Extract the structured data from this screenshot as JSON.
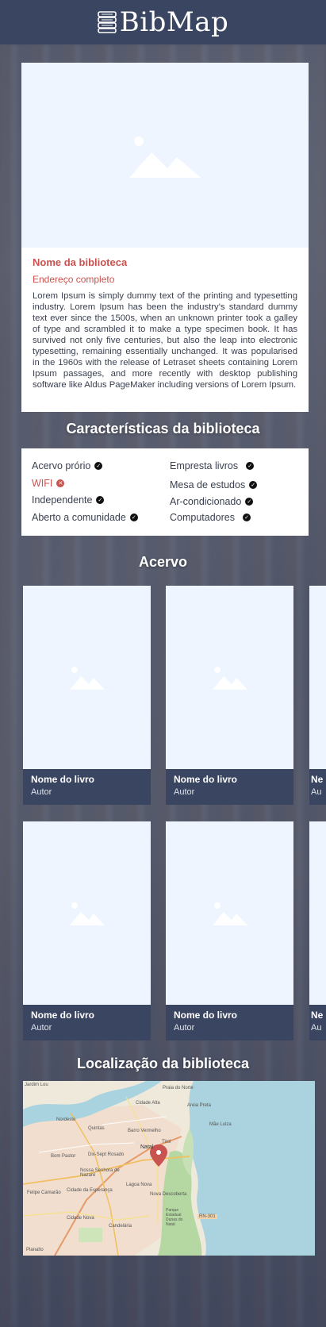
{
  "app": {
    "logo_text": "BibMap"
  },
  "library": {
    "name": "Nome da biblioteca",
    "address": "Endereço completo",
    "description": "Lorem Ipsum is simply dummy text of the printing and typesetting industry. Lorem Ipsum has been the industry's standard dummy text ever since the 1500s, when an unknown printer took a galley of type and scrambled it to make a type specimen book. It has survived not only five centuries, but also the leap into electronic typesetting, remaining essentially unchanged. It was popularised in the 1960s with the release of Letraset sheets containing Lorem Ipsum passages, and more recently with desktop publishing software like Aldus PageMaker including versions of Lorem Ipsum."
  },
  "features": {
    "title": "Características da biblioteca",
    "items": [
      {
        "label": "Acervo prório",
        "available": true
      },
      {
        "label": "WIFI",
        "available": false
      },
      {
        "label": "Independente",
        "available": true
      },
      {
        "label": "Aberto a comunidade",
        "available": true
      },
      {
        "label": "Empresta livros",
        "available": true
      },
      {
        "label": "Mesa de estudos",
        "available": true
      },
      {
        "label": "Ar-condicionado",
        "available": true
      },
      {
        "label": "Computadores",
        "available": true
      }
    ]
  },
  "collection": {
    "title": "Acervo",
    "books": [
      {
        "title": "Nome do livro",
        "author": "Autor"
      },
      {
        "title": "Nome do livro",
        "author": "Autor"
      },
      {
        "title": "Ne",
        "author": "Au"
      },
      {
        "title": "Nome do livro",
        "author": "Autor"
      },
      {
        "title": "Nome do livro",
        "author": "Autor"
      },
      {
        "title": "Ne",
        "author": "Au"
      }
    ]
  },
  "location": {
    "title": "Localização da biblioteca",
    "map_labels": {
      "jardim_lou": "Jardim Lou",
      "praia_norte": "Praia do Norte",
      "cidade_alta": "Cidade Alta",
      "areia_preta": "Areia Preta",
      "mae_luiza": "Mãe Luiza",
      "nordeste": "Nordeste",
      "quintas": "Quintas",
      "barro_vermelho": "Barro Vermelho",
      "natal": "Natal",
      "tirol": "Tirol",
      "bom_pastor": "Bom Pastor",
      "dix_sept_rosado": "Dix-Sept Rosado",
      "nossa_senhora": "Nossa Senhora de Nazaré",
      "lagoa_nova": "Lagoa Nova",
      "nova_descoberta": "Nova Descoberta",
      "felipe_camarao": "Felipe Camarão",
      "cidade_esperanca": "Cidade da Esperança",
      "cidade_nova": "Cidade Nova",
      "candelaria": "Candelária",
      "parque_dunas": "Parque Estadual Dunas do Natal",
      "road_rn301": "RN-301",
      "planalto": "Planalto"
    }
  },
  "colors": {
    "header": "#3a4561",
    "accent_red": "#c9534f",
    "placeholder_bg": "#eef5ff"
  }
}
